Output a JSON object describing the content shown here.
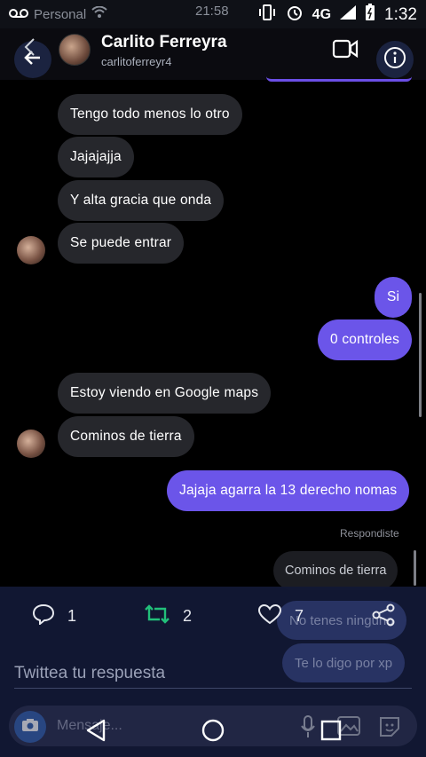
{
  "status_bar": {
    "carrier": "Personal",
    "center_time": "21:58",
    "network": "4G",
    "clock": "1:32"
  },
  "header": {
    "name": "Carlito Ferreyra",
    "handle": "carlitoferreyr4"
  },
  "messages": [
    {
      "dir": "in",
      "text": "Tengo todo menos lo otro"
    },
    {
      "dir": "in",
      "text": "Jajajajja"
    },
    {
      "dir": "in",
      "text": "Y alta gracia que onda"
    },
    {
      "dir": "in",
      "text": "Se puede entrar"
    },
    {
      "dir": "out",
      "text": "Si"
    },
    {
      "dir": "out",
      "text": "0 controles"
    },
    {
      "dir": "in",
      "text": "Estoy viendo en Google  maps"
    },
    {
      "dir": "in",
      "text": "Cominos de tierra"
    },
    {
      "dir": "out",
      "text": "Jajaja agarra la 13 derecho nomas"
    }
  ],
  "reply_context": {
    "label": "Respondiste",
    "quoted": "Cominos de tierra"
  },
  "ghost_messages": [
    "No tenes ninguno",
    "Te lo digo por xp"
  ],
  "tweet": {
    "replies": "1",
    "retweets": "2",
    "likes": "7",
    "reply_placeholder": "Twittea tu respuesta"
  },
  "composer": {
    "placeholder": "Mensaje..."
  },
  "colors": {
    "outgoing": "#6b55e9",
    "incoming": "#26272c",
    "retweet": "#22c07a",
    "panel": "#121834"
  }
}
